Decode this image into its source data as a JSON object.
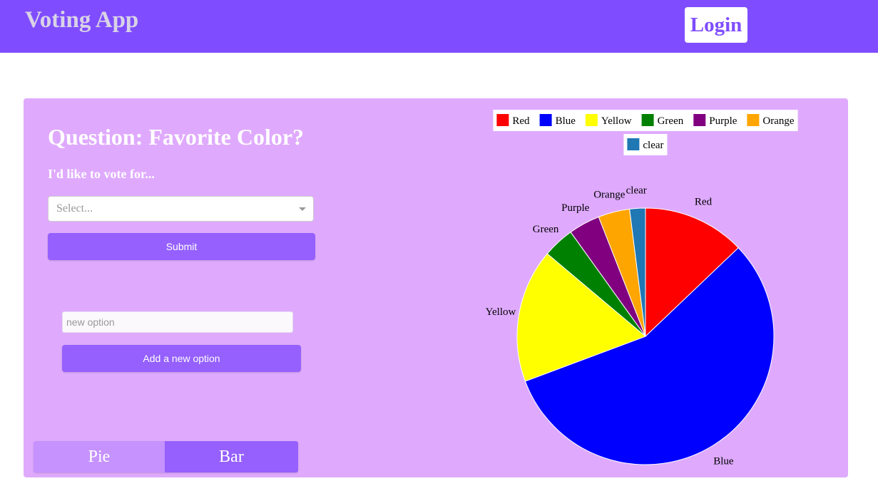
{
  "navbar": {
    "brand": "Voting App",
    "login_label": "Login",
    "background": "#7f4dff"
  },
  "poll": {
    "question": "Question: Favorite Color?",
    "prompt": "I'd like to vote for...",
    "select_placeholder": "Select...",
    "submit_label": "Submit",
    "new_option_placeholder": "new option",
    "add_option_label": "Add a new option",
    "panel_background": "#dfaafd"
  },
  "chart_toggle": {
    "pie_label": "Pie",
    "bar_label": "Bar",
    "active": "Pie"
  },
  "chart_data": {
    "type": "pie",
    "legend_placement": "top",
    "slices": [
      {
        "label": "Red",
        "value": 13,
        "color": "#ff0000"
      },
      {
        "label": "Blue",
        "value": 57,
        "color": "#0000ff"
      },
      {
        "label": "Yellow",
        "value": 17,
        "color": "#ffff00"
      },
      {
        "label": "Green",
        "value": 4,
        "color": "#008000"
      },
      {
        "label": "Purple",
        "value": 4,
        "color": "#800080"
      },
      {
        "label": "Orange",
        "value": 4,
        "color": "#ffa500"
      },
      {
        "label": "clear",
        "value": 2,
        "color": "#1f77b4"
      }
    ]
  }
}
